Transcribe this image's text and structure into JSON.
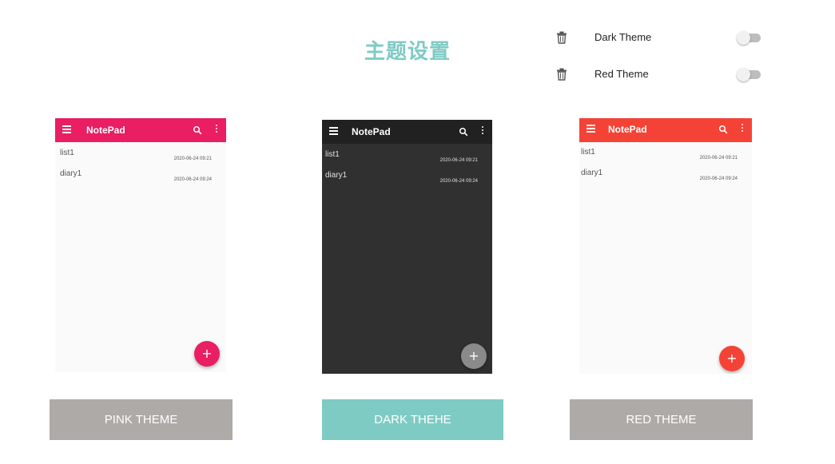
{
  "page": {
    "title": "主题设置"
  },
  "settings": [
    {
      "label": "Dark Theme",
      "enabled": false
    },
    {
      "label": "Red Theme",
      "enabled": false
    }
  ],
  "previews": [
    {
      "app_title": "NotePad",
      "bar_color": "#e91e63",
      "bg_color": "#fafafa",
      "text_color": "#555555",
      "fab_color": "#e91e63",
      "fab_symbol": "+",
      "notes": [
        {
          "title": "list1",
          "date": "2020-06-24 09:21"
        },
        {
          "title": "diary1",
          "date": "2020-06-24 09:24"
        }
      ]
    },
    {
      "app_title": "NotePad",
      "bar_color": "#212121",
      "bg_color": "#303030",
      "text_color": "#e0e0e0",
      "fab_color": "#8a8a8a",
      "fab_symbol": "+",
      "notes": [
        {
          "title": "list1",
          "date": "2020-06-24 09:21"
        },
        {
          "title": "diary1",
          "date": "2020-06-24 09:24"
        }
      ]
    },
    {
      "app_title": "NotePad",
      "bar_color": "#f44336",
      "bg_color": "#fafafa",
      "text_color": "#555555",
      "fab_color": "#f44336",
      "fab_symbol": "+",
      "notes": [
        {
          "title": "list1",
          "date": "2020-06-24 09:21"
        },
        {
          "title": "diary1",
          "date": "2020-06-24 09:24"
        }
      ]
    }
  ],
  "buttons": [
    {
      "label": "PINK THEME",
      "color": "#aeaaa8"
    },
    {
      "label": "DARK THEHE",
      "color": "#7ecbc4"
    },
    {
      "label": "RED THEME",
      "color": "#aeaaa8"
    }
  ],
  "icons": {
    "setting_icon": "trash-icon",
    "toggle": "switch-off"
  }
}
